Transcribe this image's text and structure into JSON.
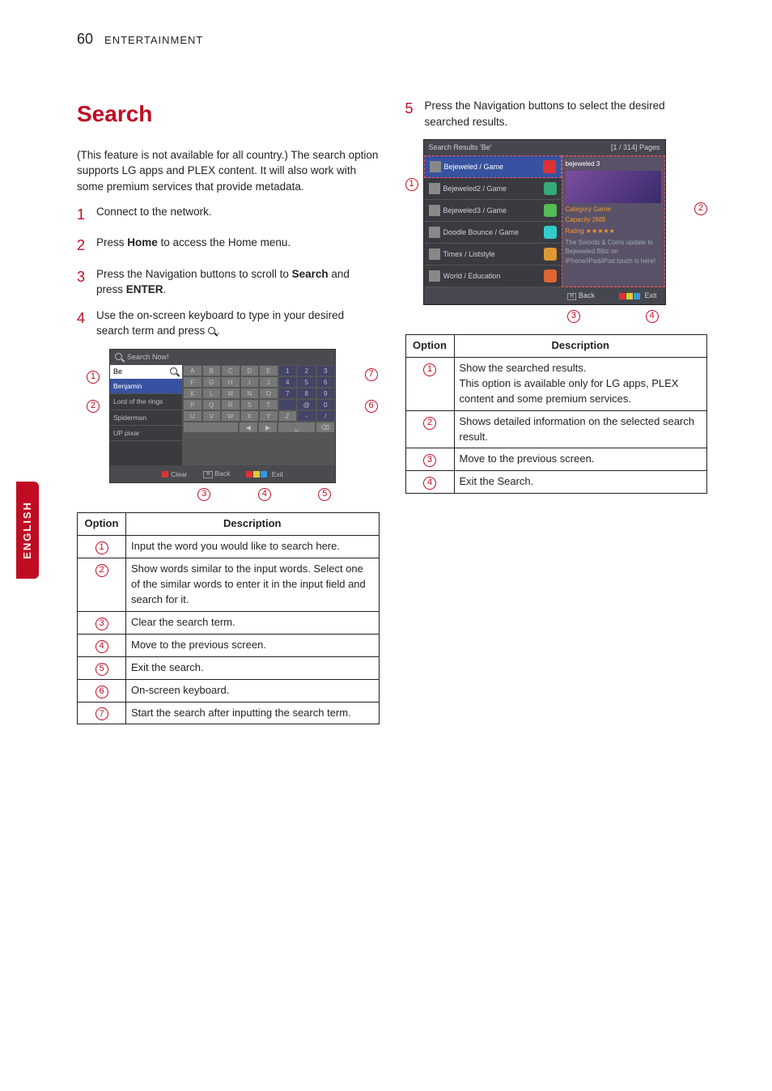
{
  "page": {
    "number": "60",
    "section": "ENTERTAINMENT",
    "langTab": "ENGLISH"
  },
  "left": {
    "title": "Search",
    "intro": "(This feature is not available for all country.) The search option supports LG apps and PLEX content. It will also work with some premium services that provide metadata.",
    "step1": "Connect to the network.",
    "step2a": "Press ",
    "step2b": "Home",
    "step2c": " to access the Home menu.",
    "step3a": "Press the Navigation buttons to scroll to ",
    "step3b": "Search",
    "step3c": " and press ",
    "step3d": "ENTER",
    "step3e": ".",
    "step4a": "Use the on-screen keyboard to type in your desired search term and press ",
    "sch": {
      "head": "Search Now!",
      "input": "Be",
      "sug1": "Benjamin",
      "sug2": "Lord of the rings",
      "sug3": "Spiderman",
      "sug4": "UP pixar",
      "clear": "Clear",
      "back": "Back",
      "exit": "Exit"
    },
    "table": {
      "h1": "Option",
      "h2": "Description",
      "r1": "Input the word you would like to search here.",
      "r2": "Show words similar to the input words. Select one of the similar words to enter it in the input field and search for it.",
      "r3": "Clear the search term.",
      "r4": "Move to the previous screen.",
      "r5": "Exit the search.",
      "r6": "On-screen keyboard.",
      "r7": "Start the search after inputting the search term."
    }
  },
  "right": {
    "step5": "Press the Navigation buttons to select the desired searched results.",
    "res": {
      "head": "Search Results 'Be'",
      "pages": "[1 / 314] Pages",
      "i1": "Bejeweled / Game",
      "i2": "Bejeweled2 / Game",
      "i3": "Bejeweled3 / Game",
      "i4": "Doodle Bounce / Game",
      "i5": "Timex / Liststyle",
      "i6": "World / Education",
      "dTitle": "bejeweled 3",
      "dCat": "Category Game",
      "dCap": "Capacity 2MB",
      "dRate": "Rating ★★★★★",
      "dDesc": "The Swords & Coins update to Bejeweled Blitz on iPhone/iPad/iPod touch is here!",
      "back": "Back",
      "exit": "Exit"
    },
    "table": {
      "h1": "Option",
      "h2": "Description",
      "r1": "Show the searched results.\nThis option is available only for LG apps, PLEX content and some premium services.",
      "r2": "Shows detailed information on the selected search result.",
      "r3": "Move to the previous screen.",
      "r4": "Exit the Search."
    }
  },
  "n": {
    "1": "1",
    "2": "2",
    "3": "3",
    "4": "4",
    "5": "5",
    "6": "6",
    "7": "7"
  }
}
